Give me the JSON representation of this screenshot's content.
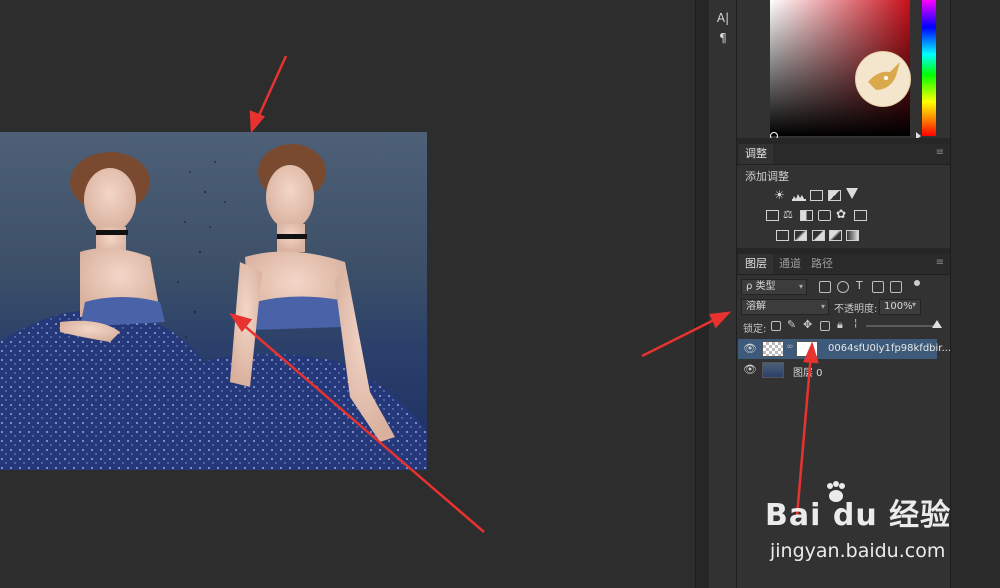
{
  "toolstrip": {
    "char_tool_label": "A|",
    "para_tool_label": "¶"
  },
  "adjustments": {
    "tab_label": "调整",
    "subtitle": "添加调整"
  },
  "layers": {
    "tabs": [
      "图层",
      "通道",
      "路径"
    ],
    "filter_kind": "ρ 类型",
    "blend_mode": "溶解",
    "opacity_label": "不透明度:",
    "opacity_value": "100%",
    "lock_label": "锁定:",
    "items": [
      {
        "name": "0064sfU0ly1fp98kfdbir...",
        "selected": true
      },
      {
        "name": "图层 0",
        "selected": false
      }
    ]
  },
  "watermark": {
    "brand": "Bai du 经验",
    "url": "jingyan.baidu.com"
  },
  "colors": {
    "annotation_arrow": "#e8322f",
    "selected_layer": "#3d5a7a",
    "panel_bg": "#323232"
  }
}
